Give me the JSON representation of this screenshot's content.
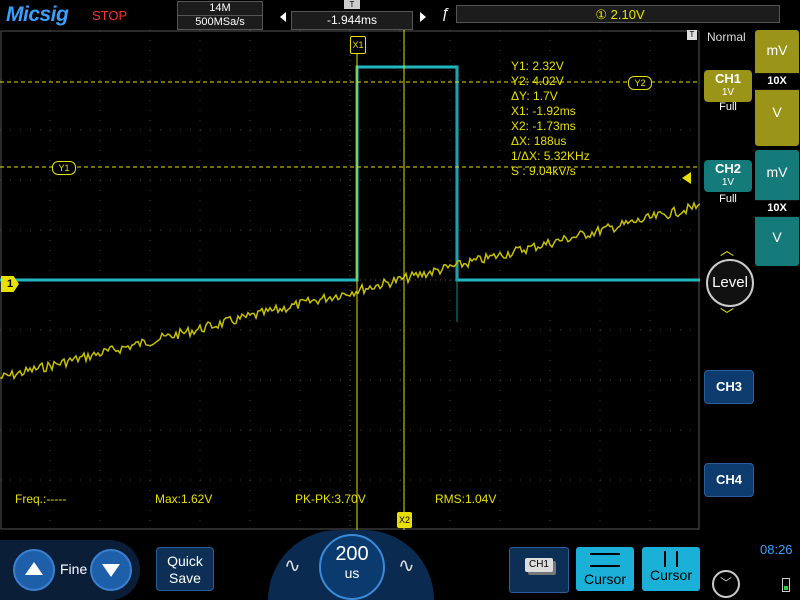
{
  "header": {
    "logo": "Micsig",
    "run_state": "STOP",
    "memory_depth": "14M",
    "sample_rate": "500MSa/s",
    "trigger_delay": "-1.944ms",
    "trigger_marker": "T",
    "trigger_source": "①",
    "trigger_level": "2.10V"
  },
  "trigger_mode": "Normal",
  "cursors": {
    "x1_tag": "X1",
    "x2_tag": "X2",
    "y1_tag": "Y1",
    "y2_tag": "Y2",
    "readout": [
      "Y1:  2.32V",
      "Y2:  4.02V",
      "ΔY:  1.7V",
      "X1:  -1.92ms",
      "X2:  -1.73ms",
      "ΔX:  188us",
      "1/ΔX:  5.32KHz",
      "S :  9.04kV/s"
    ]
  },
  "ch1_ground_marker": "1",
  "measurements": {
    "freq": "Freq.:-----",
    "max": "Max:1.62V",
    "pkpk": "PK-PK:3.70V",
    "rms": "RMS:1.04V"
  },
  "right_panel": {
    "ch1": {
      "label": "CH1",
      "scale": "1V",
      "bw": "Full",
      "unit": "mV",
      "probe": "10X",
      "color": "#b8b020"
    },
    "ch2": {
      "label": "CH2",
      "scale": "1V",
      "bw": "Full",
      "unit": "mV",
      "probe": "10X",
      "color": "#1a9a9a"
    },
    "level_label": "Level",
    "ch3_label": "CH3",
    "ch4_label": "CH4"
  },
  "bottom": {
    "fine_label": "Fine",
    "quick_save_line1": "Quick",
    "quick_save_line2": "Save",
    "timebase_value": "200",
    "timebase_unit": "us",
    "ch_select_label": "CH1",
    "cursor_h_label": "Cursor",
    "cursor_v_label": "Cursor",
    "clock": "08:26"
  },
  "colors": {
    "ch1": "#e8e000",
    "ch2": "#20b8c0",
    "cursor": "#e8e000"
  }
}
